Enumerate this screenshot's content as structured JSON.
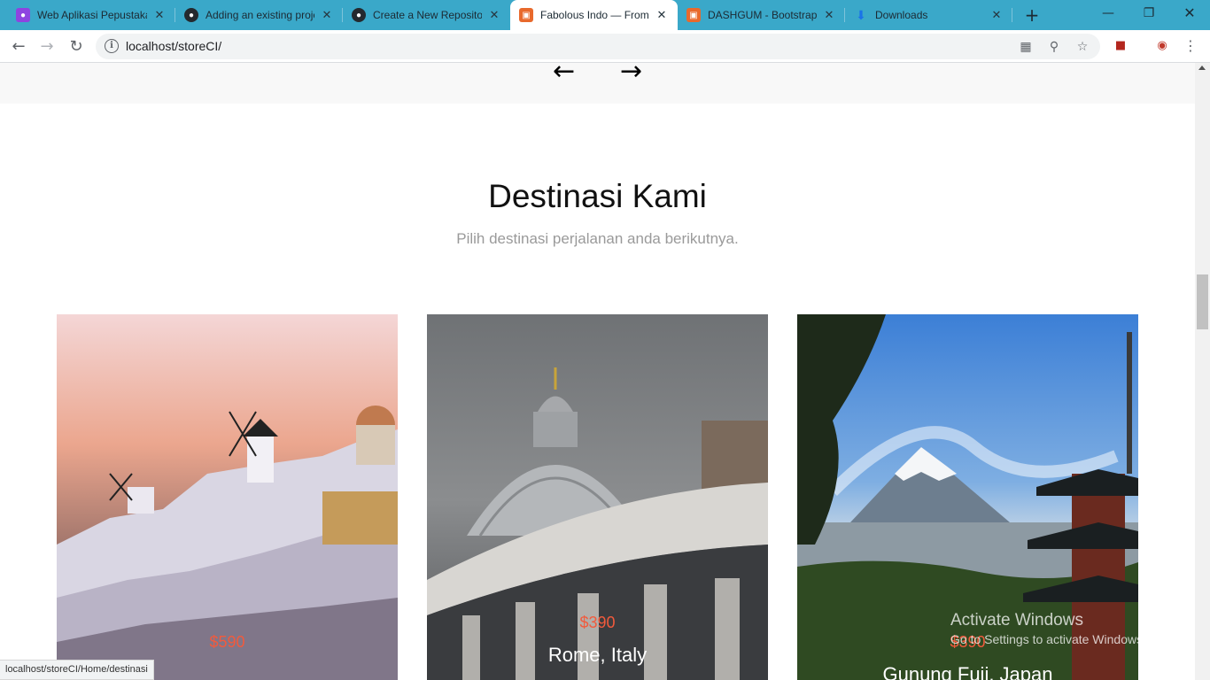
{
  "tabs": [
    {
      "title": "Web Aplikasi Pepustakaan",
      "icon": "purple-user-icon",
      "color": "#8e44e0"
    },
    {
      "title": "Adding an existing project",
      "icon": "github-icon",
      "color": "#24292e"
    },
    {
      "title": "Create a New Repository",
      "icon": "github-icon",
      "color": "#24292e"
    },
    {
      "title": "Fabolous Indo — From",
      "icon": "orange-app-icon",
      "color": "#e8692c"
    },
    {
      "title": "DASHGUM - Bootstrap",
      "icon": "orange-app-icon",
      "color": "#e8692c"
    },
    {
      "title": "Downloads",
      "icon": "download-icon",
      "color": "#1a73e8"
    }
  ],
  "address": {
    "url": "localhost/storeCI/"
  },
  "page": {
    "title": "Destinasi Kami",
    "subtitle": "Pilih destinasi perjalanan anda berikutnya.",
    "prev_arrow": "←",
    "next_arrow": "→"
  },
  "cards": [
    {
      "price": "$590",
      "name": "",
      "theme": "santorini"
    },
    {
      "price": "$390",
      "name": "Rome, Italy",
      "theme": "rome"
    },
    {
      "price": "$390",
      "name": "Gunung Fuji, Japan",
      "theme": "fuji"
    }
  ],
  "status_url": "localhost/storeCI/Home/destinasi",
  "watermark": {
    "line1": "Activate Windows",
    "line2": "Go to Settings to activate Windows."
  },
  "colors": {
    "tabbar": "#3aa8c9",
    "price": "#f25a3c"
  }
}
